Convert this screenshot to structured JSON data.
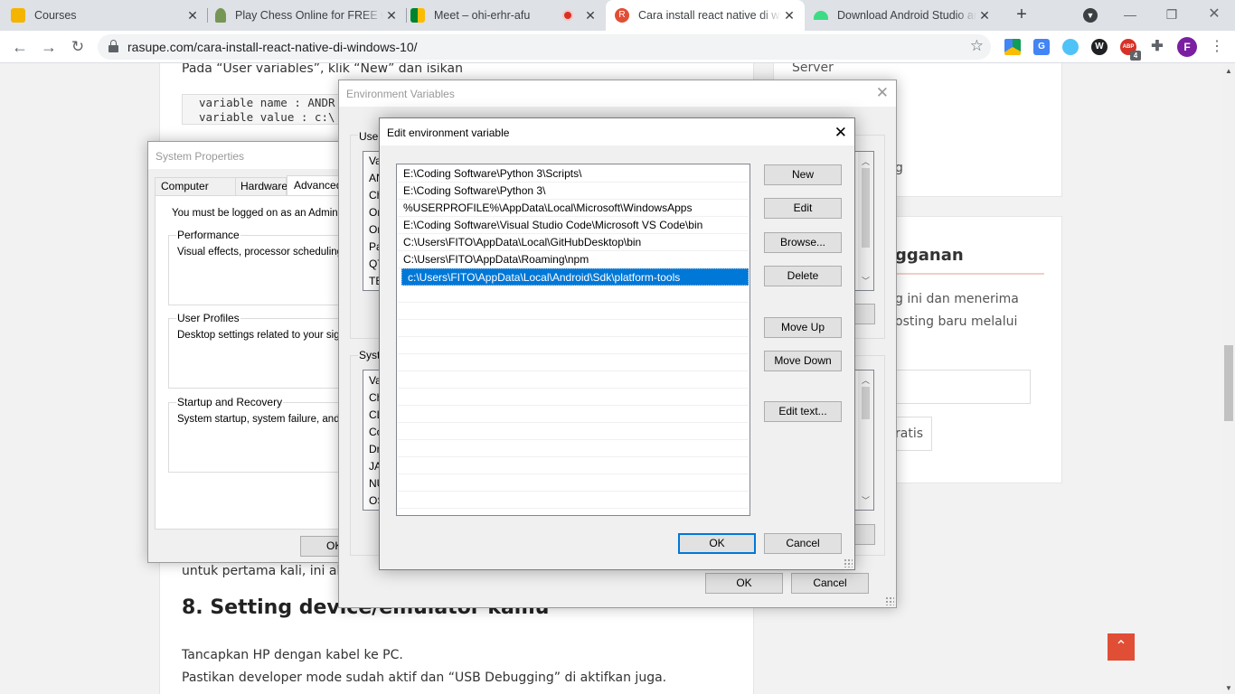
{
  "browser": {
    "tabs": [
      {
        "title": "Courses",
        "favicon_color": "#f4b400"
      },
      {
        "title": "Play Chess Online for FREE with",
        "favicon_color": "#769656"
      },
      {
        "title": "Meet – ohi-erhr-afu",
        "favicon_color": "#00897b"
      },
      {
        "title": "Cara install react native di windows",
        "favicon_color": "#e14e36"
      },
      {
        "title": "Download Android Studio and",
        "favicon_color": "#3ddc84"
      }
    ],
    "active_tab_index": 3,
    "url": "rasupe.com/cara-install-react-native-di-windows-10/",
    "extensions": [
      {
        "name": "drive-icon",
        "color": "#1e8e3e",
        "label": ""
      },
      {
        "name": "translate-icon",
        "color": "#4285f4",
        "label": "G"
      },
      {
        "name": "lens-icon",
        "color": "#4fc3f7",
        "label": ""
      },
      {
        "name": "wordpress-icon",
        "color": "#202124",
        "label": "W"
      },
      {
        "name": "adblock-icon",
        "color": "#d93025",
        "label": "ABP",
        "badge": "4"
      },
      {
        "name": "puzzle-icon",
        "color": "#5f6368",
        "label": ""
      },
      {
        "name": "profile-avatar",
        "color": "#7b1fa2",
        "label": "F"
      }
    ]
  },
  "article": {
    "intro": "Pada “User variables”, klik “New” dan isikan",
    "code_line1": "variable name : ANDR",
    "code_line2": "variable value : c:\\",
    "partial_line": "untuk pertama kali, ini akan",
    "heading": "8. Setting device/emulator kamu",
    "para1": "Tancapkan HP dengan kabel ke PC.",
    "para2": "Pastikan developer mode sudah aktif dan “USB Debugging” di aktifkan juga."
  },
  "sidebar": {
    "server_text": "Server",
    "g_text": "g",
    "subscribe_heading": "gganan",
    "subscribe_line1": "g ini dan menerima",
    "subscribe_line2": "osting baru melalui",
    "subscribe_button": "ratis"
  },
  "system_properties": {
    "title": "System Properties",
    "tabs": [
      "Computer Name",
      "Hardware",
      "Advanced"
    ],
    "admin_note": "You must be logged on as an Administrat",
    "groups": [
      {
        "label": "Performance",
        "text": "Visual effects, processor scheduling, m"
      },
      {
        "label": "User Profiles",
        "text": "Desktop settings related to your sign-in"
      },
      {
        "label": "Startup and Recovery",
        "text": "System startup, system failure, and deb"
      }
    ],
    "ok_button": "OK"
  },
  "env_vars": {
    "title": "Environment Variables",
    "user_group": "User",
    "user_rows": [
      "Va",
      "AN",
      "Ch",
      "On",
      "On",
      "Pa",
      "QT",
      "TE"
    ],
    "system_group": "Syste",
    "system_rows": [
      "Va",
      "Ch",
      "CL",
      "Co",
      "Dr",
      "JA",
      "NU",
      "OS"
    ],
    "ok_button": "OK",
    "cancel_button": "Cancel"
  },
  "edit_env": {
    "title": "Edit environment variable",
    "paths": [
      "E:\\Coding Software\\Python 3\\Scripts\\",
      "E:\\Coding Software\\Python 3\\",
      "%USERPROFILE%\\AppData\\Local\\Microsoft\\WindowsApps",
      "E:\\Coding Software\\Visual Studio Code\\Microsoft VS Code\\bin",
      "C:\\Users\\FITO\\AppData\\Local\\GitHubDesktop\\bin",
      "C:\\Users\\FITO\\AppData\\Roaming\\npm",
      "c:\\Users\\FITO\\AppData\\Local\\Android\\Sdk\\platform-tools"
    ],
    "selected_index": 6,
    "buttons": {
      "new": "New",
      "edit": "Edit",
      "browse": "Browse...",
      "delete": "Delete",
      "move_up": "Move Up",
      "move_down": "Move Down",
      "edit_text": "Edit text..."
    },
    "ok_button": "OK",
    "cancel_button": "Cancel"
  }
}
